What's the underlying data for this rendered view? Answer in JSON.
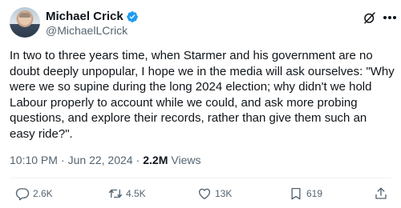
{
  "author": {
    "display_name": "Michael Crick",
    "handle": "@MichaelLCrick",
    "verified": true
  },
  "tweet": {
    "text": "In two to three years time, when Starmer and his government are no doubt deeply unpopular, I hope we in the media will ask ourselves: \"Why were we so supine during the long 2024 election; why didn't we hold Labour properly to account while we could, and ask more probing questions, and explore their records, rather than give them such an easy ride?\".",
    "time": "10:10 PM",
    "date": "Jun 22, 2024",
    "separator": "·",
    "views_count": "2.2M",
    "views_label": "Views"
  },
  "actions": {
    "replies": "2.6K",
    "reposts": "4.5K",
    "likes": "13K",
    "bookmarks": "619"
  },
  "icons": {
    "verified": "verified-badge-icon",
    "grok": "grok-icon",
    "more": "more-icon",
    "reply": "reply-icon",
    "repost": "repost-icon",
    "like": "heart-icon",
    "bookmark": "bookmark-icon",
    "share": "share-icon"
  },
  "colors": {
    "verified_blue": "#1d9bf0",
    "secondary_text": "#536471",
    "primary_text": "#0f1419"
  }
}
